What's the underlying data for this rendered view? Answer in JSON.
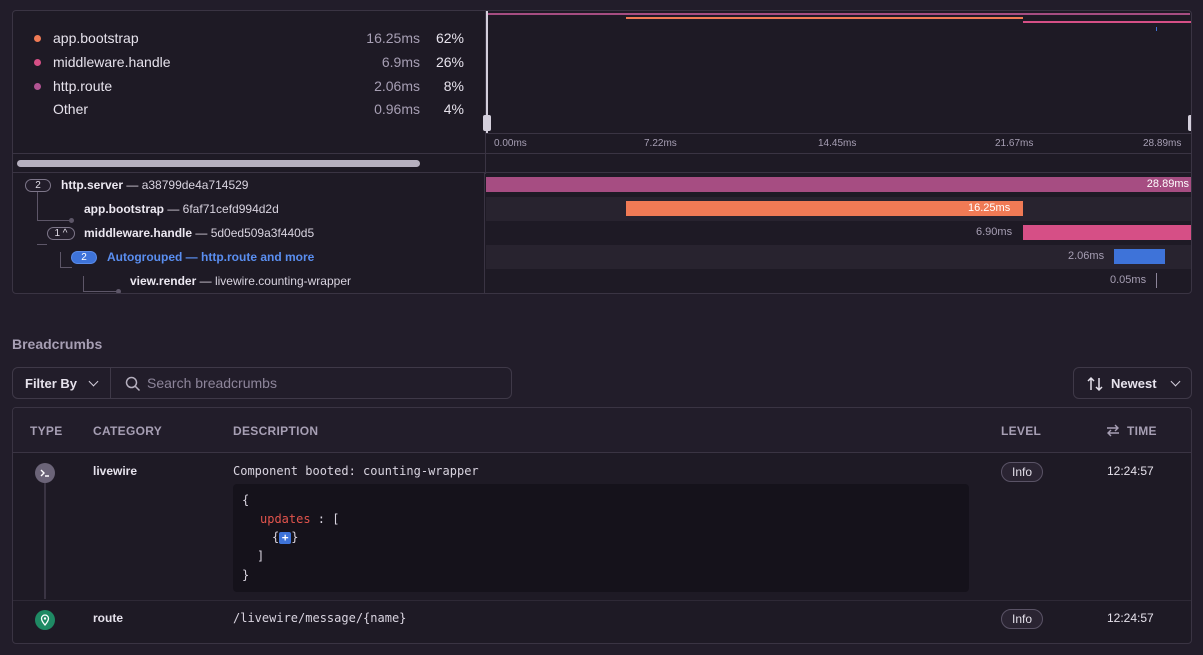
{
  "summary": [
    {
      "name": "app.bootstrap",
      "duration": "16.25ms",
      "percent": "62%",
      "color": "#f07a55"
    },
    {
      "name": "middleware.handle",
      "duration": "6.9ms",
      "percent": "26%",
      "color": "#d64f86"
    },
    {
      "name": "http.route",
      "duration": "2.06ms",
      "percent": "8%",
      "color": "#b25493"
    },
    {
      "name": "Other",
      "duration": "0.96ms",
      "percent": "4%",
      "color": ""
    }
  ],
  "minimap": {
    "ticks": [
      "0.00ms",
      "7.22ms",
      "14.45ms",
      "21.67ms",
      "28.89ms"
    ]
  },
  "tree": [
    {
      "badge": "2",
      "op": "http.server",
      "desc": "a38799de4a714529",
      "duration": "28.89ms",
      "color": "#a64d82"
    },
    {
      "badge": "",
      "op": "app.bootstrap",
      "desc": "6faf71cefd994d2d",
      "duration": "16.25ms",
      "color": "#f07a55"
    },
    {
      "badge": "1",
      "op": "middleware.handle",
      "desc": "5d0ed509a3f440d5",
      "duration": "6.90ms",
      "color": "#d64f86"
    },
    {
      "badge": "2",
      "op": "Autogrouped",
      "desc": "http.route and more",
      "duration": "2.06ms",
      "color": "#3e73d9"
    },
    {
      "badge": "",
      "op": "view.render",
      "desc": "livewire.counting-wrapper",
      "duration": "0.05ms",
      "color": "#8d859a"
    }
  ],
  "breadcrumbs": {
    "title": "Breadcrumbs",
    "filter_label": "Filter By",
    "search_placeholder": "Search breadcrumbs",
    "sort_label": "Newest",
    "columns": {
      "type": "TYPE",
      "category": "CATEGORY",
      "description": "DESCRIPTION",
      "level": "LEVEL",
      "time": "TIME"
    },
    "rows": [
      {
        "type_icon": "terminal-icon",
        "category": "livewire",
        "description": "Component booted: counting-wrapper",
        "level": "Info",
        "time": "12:24:57"
      },
      {
        "type_icon": "location-pin-icon",
        "category": "route",
        "description": "/livewire/message/{name}",
        "level": "Info",
        "time": "12:24:57"
      }
    ],
    "json": {
      "open": "{",
      "key": "updates",
      "sep": " : [",
      "item_open": "{",
      "item_close": "}",
      "arr_close": "]",
      "close": "}"
    }
  }
}
